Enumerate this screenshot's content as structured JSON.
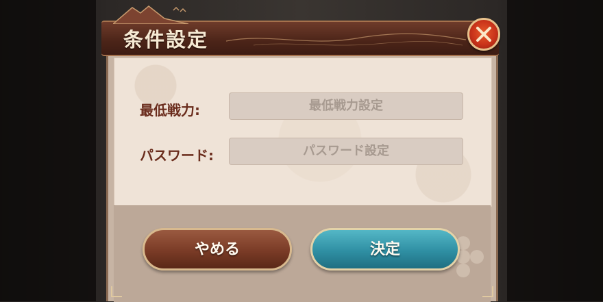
{
  "dialog": {
    "title": "条件設定",
    "close_icon": "close-x-icon",
    "fields": [
      {
        "label": "最低戦力:",
        "placeholder": "最低戦力設定",
        "value": ""
      },
      {
        "label": "パスワード:",
        "placeholder": "パスワード設定",
        "value": ""
      }
    ],
    "buttons": {
      "cancel_label": "やめる",
      "confirm_label": "決定"
    }
  },
  "colors": {
    "title_banner": "#4b2418",
    "close_button": "#c9331a",
    "cancel_button": "#7a3b26",
    "confirm_button": "#2f8fa3",
    "label_text": "#6a2c1c",
    "panel_bg": "#efe3d7"
  }
}
